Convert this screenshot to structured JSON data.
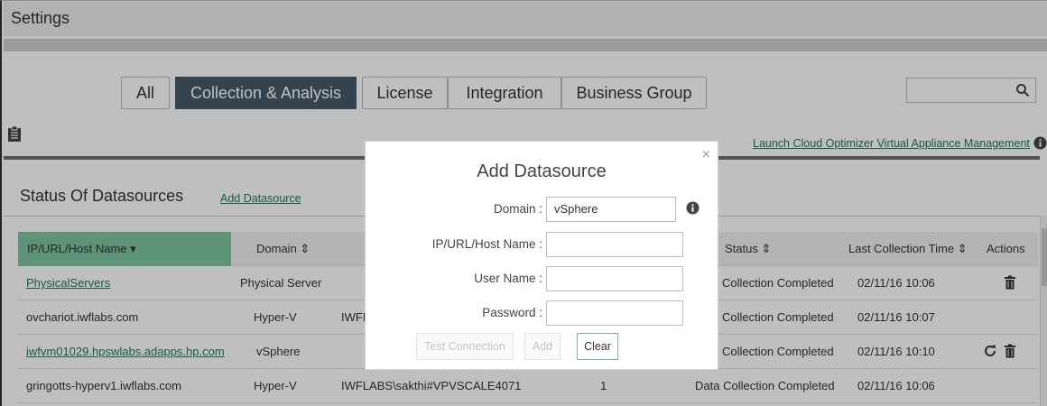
{
  "header": {
    "title": "Settings"
  },
  "tabs": [
    {
      "label": "All",
      "active": false
    },
    {
      "label": "Collection & Analysis",
      "active": true
    },
    {
      "label": "License",
      "active": false
    },
    {
      "label": "Integration",
      "active": false
    },
    {
      "label": "Business Group",
      "active": false
    }
  ],
  "search": {
    "placeholder": ""
  },
  "toolbar": {
    "launch_link": "Launch Cloud Optimizer Virtual Appliance Management"
  },
  "section": {
    "title": "Status Of Datasources",
    "add_link": "Add Datasource"
  },
  "table": {
    "columns": {
      "ip": "IP/URL/Host Name ▾",
      "domain": "Domain ⇕",
      "status": "Status ⇕",
      "last_collection": "Last Collection Time ⇕",
      "actions": "Actions"
    },
    "rows": [
      {
        "ip": "PhysicalServers",
        "domain": "Physical Server",
        "user": "",
        "count": "",
        "status": "Collection Completed",
        "time": "02/11/16 10:06"
      },
      {
        "ip": "ovchariot.iwflabs.com",
        "domain": "Hyper-V",
        "user": "IWFL",
        "count": "",
        "status": "Collection Completed",
        "time": "02/11/16 10:07"
      },
      {
        "ip": "iwfvm01029.hpswlabs.adapps.hp.com",
        "domain": "vSphere",
        "user": "",
        "count": "",
        "status": "Collection Completed",
        "time": "02/11/16 10:10"
      },
      {
        "ip": "gringotts-hyperv1.iwflabs.com",
        "domain": "Hyper-V",
        "user": "IWFLABS\\sakthi#VPVSCALE4071",
        "count": "1",
        "status": "Data Collection Completed",
        "time": "02/11/16 10:06"
      }
    ]
  },
  "modal": {
    "title": "Add Datasource",
    "close": "×",
    "fields": {
      "domain": {
        "label": "Domain  :",
        "value": "vSphere"
      },
      "host": {
        "label": "IP/URL/Host Name  :",
        "value": ""
      },
      "user": {
        "label": "User Name  :",
        "value": ""
      },
      "password": {
        "label": "Password  :",
        "value": ""
      }
    },
    "buttons": {
      "test": "Test Connection",
      "add": "Add",
      "clear": "Clear"
    }
  },
  "colors": {
    "active_tab": "#465a6b",
    "link": "#1d7a5e",
    "sort_header": "#7dc4a2"
  }
}
